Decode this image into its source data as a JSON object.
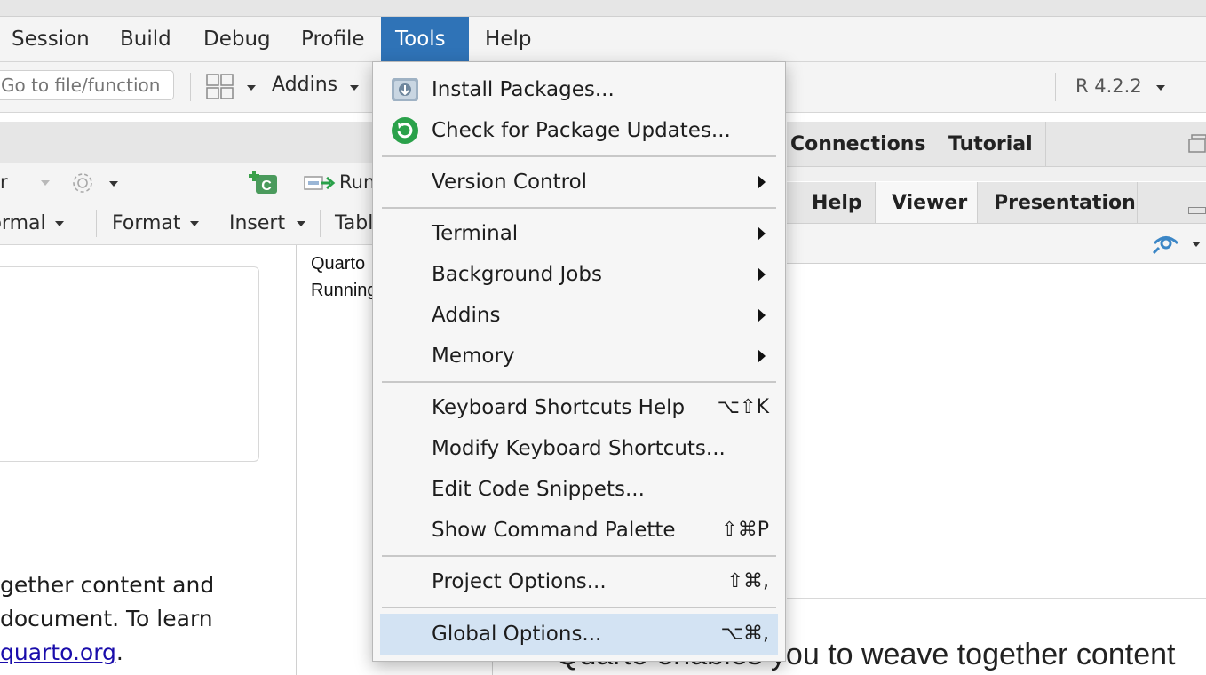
{
  "menubar": {
    "items": [
      "Session",
      "Build",
      "Debug",
      "Profile",
      "Tools",
      "Help"
    ],
    "active": "Tools"
  },
  "toolbar": {
    "goto_placeholder": "Go to file/function",
    "addins_label": "Addins",
    "r_version": "R 4.2.2"
  },
  "editor": {
    "toolbar1": {
      "run_label": "Run",
      "leading_fragment": "r"
    },
    "toolbar2": {
      "normal_label": "Normal",
      "format_label": "Format",
      "insert_label": "Insert",
      "table_label": "Table"
    },
    "body_lines": [
      "gether content and",
      "document. To learn"
    ],
    "link_text": "quarto.org",
    "link_suffix": "."
  },
  "outline": {
    "lines": [
      "Quarto",
      "Running"
    ]
  },
  "right_pane": {
    "top_tabs": [
      "Connections",
      "Tutorial"
    ],
    "bottom_tabs": [
      "Help",
      "Viewer",
      "Presentation"
    ],
    "selected_tab": "Viewer",
    "viewer_text": "Quarto enables you to weave together content"
  },
  "tools_menu": {
    "groups": [
      [
        {
          "label": "Install Packages...",
          "icon": "install-packages-icon"
        },
        {
          "label": "Check for Package Updates...",
          "icon": "package-updates-icon"
        }
      ],
      [
        {
          "label": "Version Control",
          "submenu": true
        }
      ],
      [
        {
          "label": "Terminal",
          "submenu": true
        },
        {
          "label": "Background Jobs",
          "submenu": true
        },
        {
          "label": "Addins",
          "submenu": true
        },
        {
          "label": "Memory",
          "submenu": true
        }
      ],
      [
        {
          "label": "Keyboard Shortcuts Help",
          "shortcut": "⌥⇧K"
        },
        {
          "label": "Modify Keyboard Shortcuts..."
        },
        {
          "label": "Edit Code Snippets..."
        },
        {
          "label": "Show Command Palette",
          "shortcut": "⇧⌘P"
        }
      ],
      [
        {
          "label": "Project Options...",
          "shortcut": "⇧⌘,"
        }
      ],
      [
        {
          "label": "Global Options...",
          "shortcut": "⌥⌘,",
          "highlighted": true
        }
      ]
    ]
  },
  "colors": {
    "menu_active": "#2f73b7",
    "menu_highlight": "#d3e3f3",
    "update_icon_green": "#2aa14a",
    "link": "#1a0dab"
  }
}
